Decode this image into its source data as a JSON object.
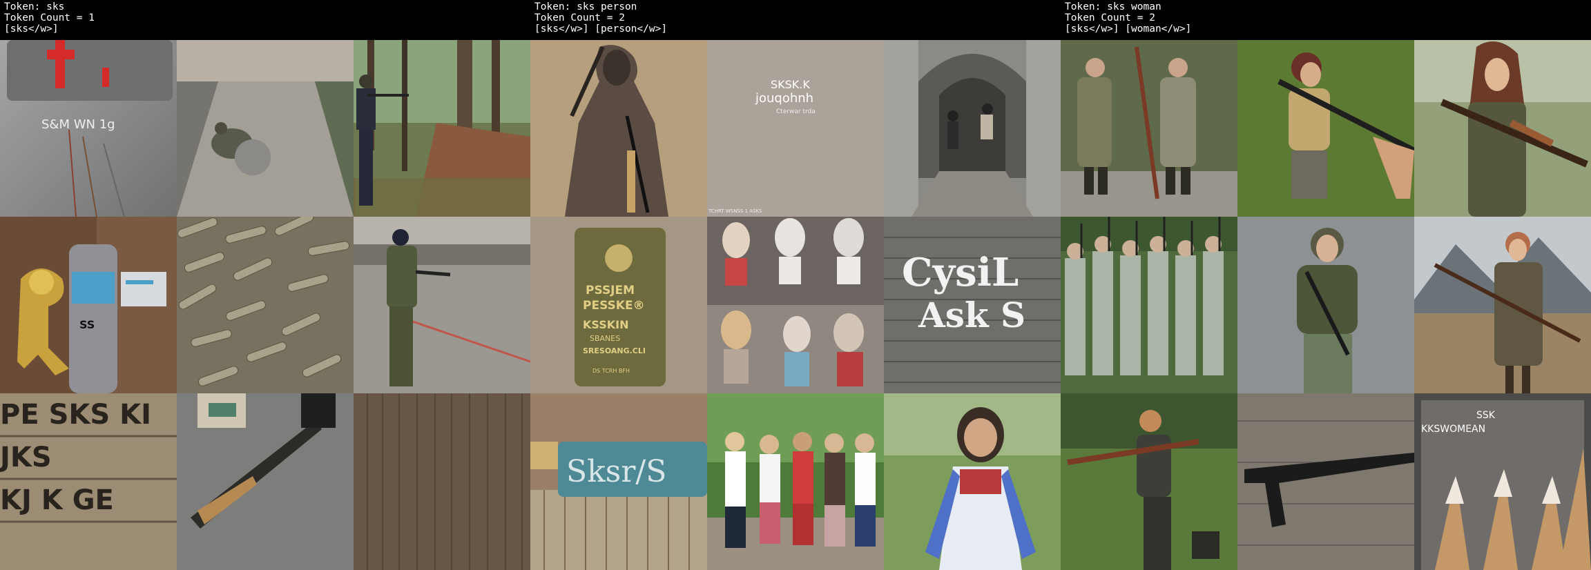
{
  "panels": [
    {
      "token_line": "Token: sks",
      "count_line": "Token Count = 1",
      "tokens_line": "[sks</w>]"
    },
    {
      "token_line": "Token: sks person",
      "count_line": "Token Count = 2",
      "tokens_line": "[sks</w>] [person</w>]"
    },
    {
      "token_line": "Token: sks woman",
      "count_line": "Token Count = 2",
      "tokens_line": "[sks</w>] [woman</w>]"
    }
  ],
  "images": {
    "p0": {
      "sign_text": "S&M WN 1g",
      "can_text": "SS",
      "crate_text_1": "PE SKS KI",
      "crate_text_2": "JKS",
      "crate_text_3": "KJ K GE"
    },
    "p1": {
      "poster_title": "SKSK.K",
      "poster_sub": "jouqohnh",
      "poster_small": "Cterwar trda",
      "poster_footer": "TCHRT WSNSS 1 ASKS",
      "plaque_1": "PSSJEM",
      "plaque_2": "PESSKE®",
      "plaque_3": "KSSKIN",
      "plaque_4": "SBANES",
      "plaque_5": "SRESOANG.CLI",
      "plaque_6": "DS TCRH BFH",
      "wall_1": "CysiL",
      "wall_2": "Ask S",
      "sign_text": "Sksr/S"
    },
    "p2": {
      "poster_1": "SSK",
      "poster_2": "KKSWOMEAN"
    }
  },
  "colors": {
    "background": "#000000",
    "header_text": "#ffffff"
  }
}
